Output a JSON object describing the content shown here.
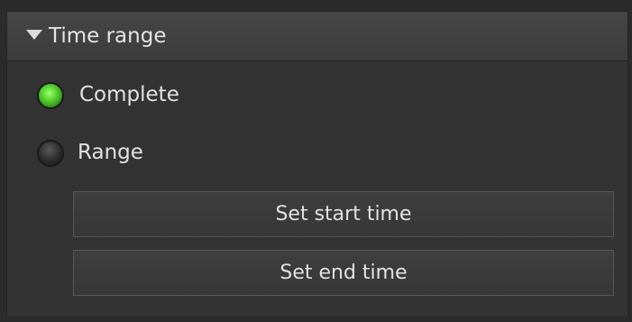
{
  "section": {
    "title": "Time range",
    "expanded": true
  },
  "options": {
    "complete": {
      "label": "Complete",
      "selected": true
    },
    "range": {
      "label": "Range",
      "selected": false
    }
  },
  "buttons": {
    "set_start": "Set start time",
    "set_end": "Set end time"
  },
  "colors": {
    "background": "#333333",
    "header": "#424242",
    "radio_on": "#5ed834",
    "radio_off": "#2c2c2c",
    "text": "#e2e2e2"
  }
}
